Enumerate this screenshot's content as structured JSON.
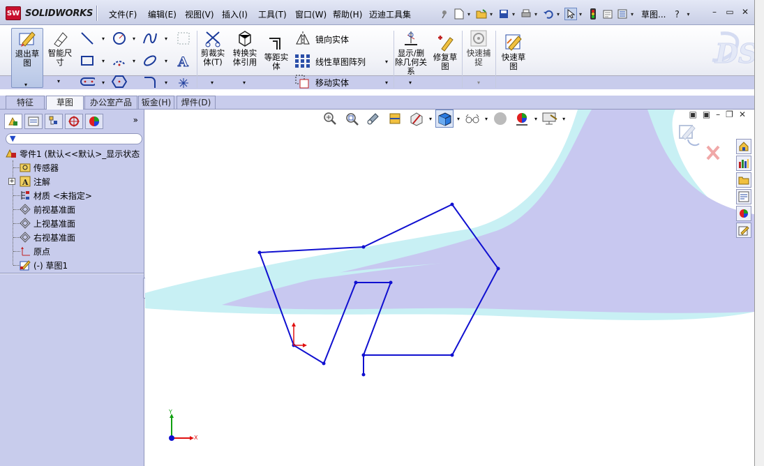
{
  "app": {
    "brand": "SOLIDWORKS",
    "brand_badge": "SW",
    "doc_title": "草图..."
  },
  "menu": [
    "文件(F)",
    "编辑(E)",
    "视图(V)",
    "插入(I)",
    "工具(T)",
    "窗口(W)",
    "帮助(H)",
    "迈迪工具集"
  ],
  "command_manager": {
    "exit_sketch": "退出草图",
    "smart_dimension": "智能尺寸",
    "trim_entities": "剪裁实体(T)",
    "convert_entities": "转换实体引用",
    "offset_entities": "等距实体",
    "mirror_entities": "镜向实体",
    "linear_pattern": "线性草图阵列",
    "move_entities": "移动实体",
    "display_relations": "显示/删除几何关系",
    "repair_sketch": "修复草图",
    "quick_snaps": "快速捕捉",
    "rapid_sketch": "快速草图"
  },
  "tabs": [
    {
      "label": "特征",
      "active": false
    },
    {
      "label": "草图",
      "active": true
    },
    {
      "label": "办公室产品",
      "active": false
    },
    {
      "label": "钣金(H)",
      "active": false
    },
    {
      "label": "焊件(D)",
      "active": false
    }
  ],
  "feature_tree": {
    "root": "零件1 (默认<<默认>_显示状态",
    "items": [
      {
        "label": "传感器",
        "icon": "sensor-icon"
      },
      {
        "label": "注解",
        "icon": "annotation-icon"
      },
      {
        "label": "材质 <未指定>",
        "icon": "material-icon"
      },
      {
        "label": "前视基准面",
        "icon": "plane-icon"
      },
      {
        "label": "上视基准面",
        "icon": "plane-icon"
      },
      {
        "label": "右视基准面",
        "icon": "plane-icon"
      },
      {
        "label": "原点",
        "icon": "origin-icon"
      },
      {
        "label": "(-) 草图1",
        "icon": "sketch-icon"
      }
    ]
  },
  "triad": {
    "x_label": "X",
    "y_label": "Y"
  },
  "colors": {
    "sketch_line": "#1010d0",
    "panel_bg": "#c8ccec",
    "bg_lavender": "#c8c8f0",
    "bg_cyan": "#c8f0f4",
    "origin_red": "#e01010"
  }
}
